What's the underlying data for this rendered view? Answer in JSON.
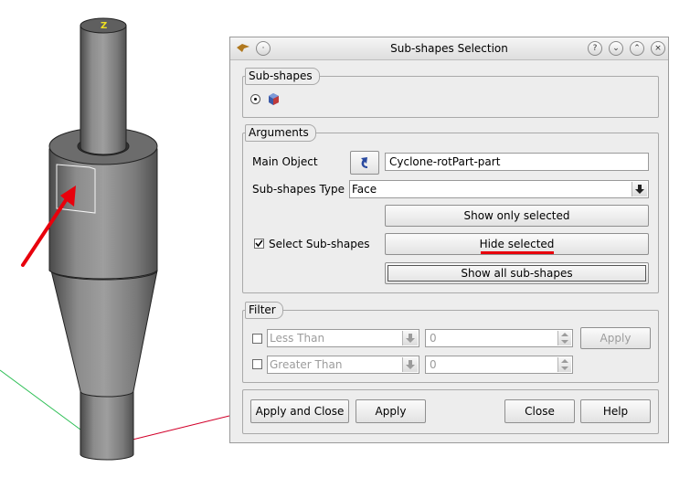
{
  "viewer": {
    "axis_label": "Z"
  },
  "dialog": {
    "title": "Sub-shapes Selection",
    "title_buttons": [
      "?",
      "v",
      "^",
      "x"
    ],
    "subshapes_group": {
      "title": "Sub-shapes"
    },
    "arguments_group": {
      "title": "Arguments",
      "main_object_label": "Main Object",
      "main_object_value": "Cyclone-rotPart-part",
      "subshape_type_label": "Sub-shapes Type",
      "subshape_type_value": "Face",
      "select_subshapes_label": "Select Sub-shapes",
      "select_subshapes_checked": true,
      "show_only_selected": "Show only selected",
      "hide_selected": "Hide selected",
      "show_all": "Show all sub-shapes"
    },
    "filter_group": {
      "title": "Filter",
      "less_than": {
        "label": "Less Than",
        "value": "0"
      },
      "greater_than": {
        "label": "Greater Than",
        "value": "0"
      },
      "apply": "Apply"
    },
    "footer": {
      "apply_close": "Apply and Close",
      "apply": "Apply",
      "close": "Close",
      "help": "Help"
    }
  },
  "colors": {
    "annotation_red": "#e8000c",
    "axis_green": "#2dbf55",
    "axis_red": "#d2002a",
    "axis_blue": "#3c46e6"
  }
}
